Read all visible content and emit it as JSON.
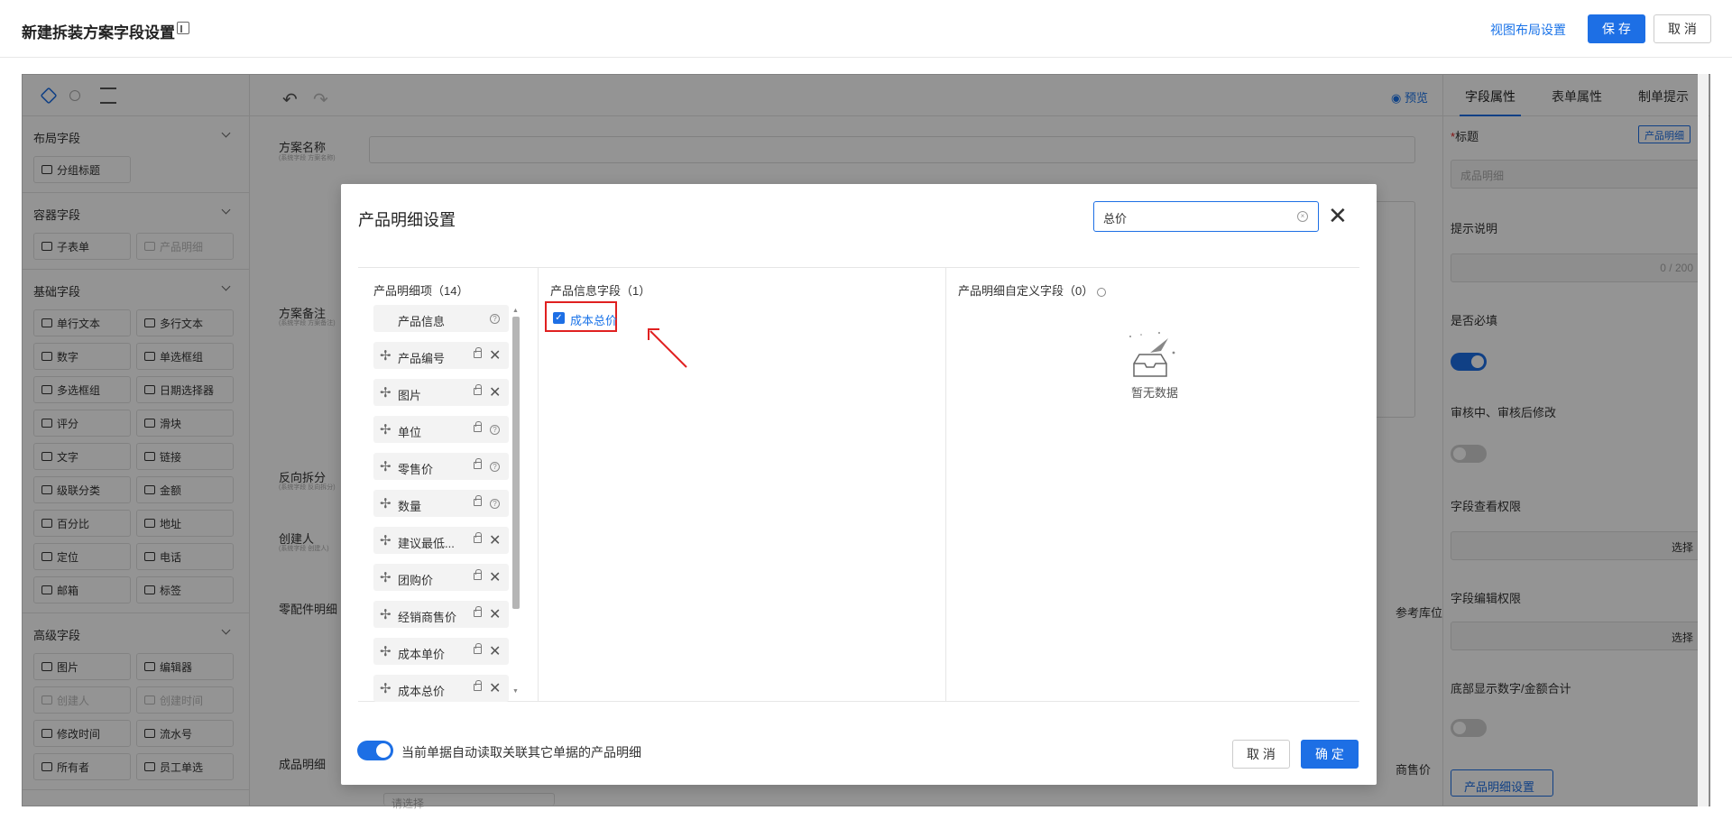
{
  "header": {
    "title": "新建拆装方案字段设置",
    "view_layout_link": "视图布局设置",
    "save": "保 存",
    "cancel": "取 消"
  },
  "left_panel": {
    "groups": [
      {
        "title": "布局字段",
        "items": [
          {
            "label": "分组标题",
            "disabled": false
          }
        ]
      },
      {
        "title": "容器字段",
        "items": [
          {
            "label": "子表单",
            "disabled": false
          },
          {
            "label": "产品明细",
            "disabled": true
          }
        ]
      },
      {
        "title": "基础字段",
        "items": [
          {
            "label": "单行文本",
            "disabled": false
          },
          {
            "label": "多行文本",
            "disabled": false
          },
          {
            "label": "数字",
            "disabled": false
          },
          {
            "label": "单选框组",
            "disabled": false
          },
          {
            "label": "多选框组",
            "disabled": false
          },
          {
            "label": "日期选择器",
            "disabled": false
          },
          {
            "label": "评分",
            "disabled": false
          },
          {
            "label": "滑块",
            "disabled": false
          },
          {
            "label": "文字",
            "disabled": false
          },
          {
            "label": "链接",
            "disabled": false
          },
          {
            "label": "级联分类",
            "disabled": false
          },
          {
            "label": "金额",
            "disabled": false
          },
          {
            "label": "百分比",
            "disabled": false
          },
          {
            "label": "地址",
            "disabled": false
          },
          {
            "label": "定位",
            "disabled": false
          },
          {
            "label": "电话",
            "disabled": false
          },
          {
            "label": "邮箱",
            "disabled": false
          },
          {
            "label": "标签",
            "disabled": false
          }
        ]
      },
      {
        "title": "高级字段",
        "items": [
          {
            "label": "图片",
            "disabled": false
          },
          {
            "label": "编辑器",
            "disabled": false
          },
          {
            "label": "创建人",
            "disabled": true
          },
          {
            "label": "创建时间",
            "disabled": true
          },
          {
            "label": "修改时间",
            "disabled": false
          },
          {
            "label": "流水号",
            "disabled": false
          },
          {
            "label": "所有者",
            "disabled": false
          },
          {
            "label": "员工单选",
            "disabled": false
          }
        ]
      }
    ]
  },
  "canvas": {
    "preview": "预览",
    "fields": {
      "plan_name": "方案名称",
      "plan_name_sub": "(系统字段 方案名称)",
      "plan_note": "方案备注",
      "plan_note_sub": "(系统字段 方案备注)",
      "reverse": "反向拆分",
      "reverse_sub": "(系统字段 反向拆分)",
      "creator": "创建人",
      "creator_sub": "(系统字段 创建人)",
      "parts_detail": "零配件明细",
      "finished_detail": "成品明细",
      "ref_location": "参考库位",
      "dealer_price": "商售价",
      "select_placeholder": "请选择"
    }
  },
  "right_panel": {
    "tabs": [
      "字段属性",
      "表单属性",
      "制单提示"
    ],
    "title_label": "标题",
    "title_tag": "产品明细",
    "title_value": "成品明细",
    "hint_label": "提示说明",
    "hint_counter": "0 / 200",
    "required_label": "是否必填",
    "required_on": true,
    "audit_label": "审核中、审核后修改",
    "audit_on": false,
    "view_perm_label": "字段查看权限",
    "edit_perm_label": "字段编辑权限",
    "select_btn": "选择",
    "bottom_sum_label": "底部显示数字/金额合计",
    "bottom_sum_on": false,
    "product_detail_btn": "产品明细设置"
  },
  "modal": {
    "title": "产品明细设置",
    "search_value": "总价",
    "col1_header": "产品明细项（14）",
    "col1_items": [
      {
        "label": "产品信息",
        "removable": false
      },
      {
        "label": "产品编号",
        "removable": true
      },
      {
        "label": "图片",
        "removable": true
      },
      {
        "label": "单位",
        "removable": false
      },
      {
        "label": "零售价",
        "removable": false
      },
      {
        "label": "数量",
        "removable": false
      },
      {
        "label": "建议最低...",
        "removable": true
      },
      {
        "label": "团购价",
        "removable": true
      },
      {
        "label": "经销商售价",
        "removable": true
      },
      {
        "label": "成本单价",
        "removable": true
      },
      {
        "label": "成本总价",
        "removable": true
      }
    ],
    "col2_header": "产品信息字段（1）",
    "col2_checked_item": "成本总价",
    "col3_header": "产品明细自定义字段（0）",
    "empty_text": "暂无数据",
    "auto_read_text": "当前单据自动读取关联其它单据的产品明细",
    "auto_read_on": true,
    "cancel": "取 消",
    "confirm": "确 定"
  }
}
